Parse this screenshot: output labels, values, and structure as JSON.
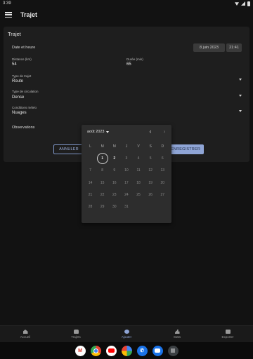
{
  "status_bar": {
    "time": "3:39"
  },
  "app_bar": {
    "title": "Trajet",
    "menu_icon": "hamburger-menu-icon"
  },
  "form": {
    "card_title": "Trajet",
    "date_time": {
      "label": "Date et heure",
      "date": "8 juin 2023",
      "time": "21:41"
    },
    "distance": {
      "label": "Distance (km)",
      "value": "54"
    },
    "duration": {
      "label": "Durée (min)",
      "value": "65"
    },
    "trip_type": {
      "label": "Type de trajet",
      "value": "Route"
    },
    "traffic": {
      "label": "Type de circulation",
      "value": "Dense"
    },
    "weather": {
      "label": "Conditions météo",
      "value": "Nuages"
    },
    "observations": {
      "label": "Observations"
    },
    "buttons": {
      "cancel": "ANNULER",
      "save": "ENREGISTRER"
    }
  },
  "calendar": {
    "month_label": "août 2023",
    "weekdays": [
      "L",
      "M",
      "M",
      "J",
      "V",
      "S",
      "D"
    ],
    "leading_blanks": 1,
    "days": [
      "1",
      "2",
      "3",
      "4",
      "5",
      "6",
      "7",
      "8",
      "9",
      "10",
      "11",
      "12",
      "13",
      "14",
      "15",
      "16",
      "17",
      "18",
      "19",
      "20",
      "21",
      "22",
      "23",
      "24",
      "25",
      "26",
      "27",
      "28",
      "29",
      "30",
      "31"
    ],
    "selected_day": "1",
    "enabled_days": [
      "1",
      "2"
    ]
  },
  "bottom_nav": [
    {
      "label": "Accueil",
      "icon": "home-icon"
    },
    {
      "label": "Trajets",
      "icon": "car-icon"
    },
    {
      "label": "Ajouter",
      "icon": "add-icon",
      "active": true
    },
    {
      "label": "Stats",
      "icon": "stats-icon"
    },
    {
      "label": "Exporter",
      "icon": "export-icon"
    }
  ],
  "dock_apps": [
    "gmail-app-icon",
    "chrome-app-icon",
    "youtube-app-icon",
    "photos-app-icon",
    "phone-app-icon",
    "messages-app-icon",
    "app-drawer-icon"
  ],
  "colors": {
    "background": "#121212",
    "card": "#1e1e1e",
    "accent": "#8fa5d6",
    "calendar_bg": "#2d2d2d"
  }
}
